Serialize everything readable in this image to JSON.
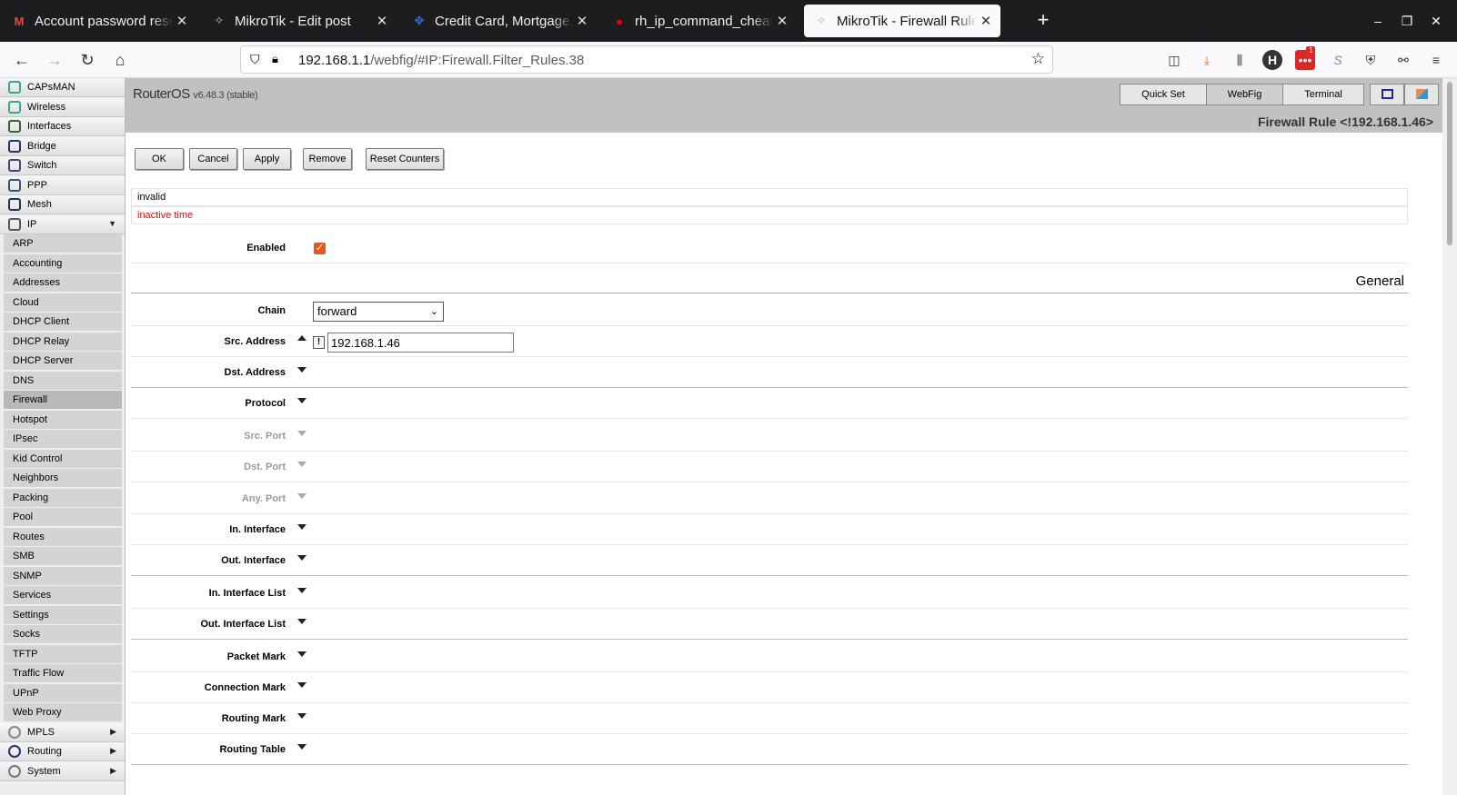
{
  "browser": {
    "tabs": [
      {
        "title": "Account password reset - ",
        "icon": "gmail-icon",
        "active": false
      },
      {
        "title": "MikroTik - Edit post",
        "icon": "mikrotik-icon",
        "active": false
      },
      {
        "title": "Credit Card, Mortgage, B",
        "icon": "chase-icon",
        "active": false
      },
      {
        "title": "rh_ip_command_cheatsh",
        "icon": "redhat-icon",
        "active": false
      },
      {
        "title": "MikroTik - Firewall Rule <",
        "icon": "mikrotik-icon",
        "active": true
      }
    ],
    "close_glyph": "✕",
    "new_tab_glyph": "+",
    "url_host": "192.168.1.1",
    "url_path": "/webfig/#IP:Firewall.Filter_Rules.38",
    "download_badge": "1"
  },
  "sidebar": {
    "top_items": [
      {
        "label": "CAPsMAN",
        "icon": "capsman-icon"
      },
      {
        "label": "Wireless",
        "icon": "wireless-icon"
      },
      {
        "label": "Interfaces",
        "icon": "interfaces-icon"
      },
      {
        "label": "Bridge",
        "icon": "bridge-icon"
      },
      {
        "label": "Switch",
        "icon": "switch-icon"
      },
      {
        "label": "PPP",
        "icon": "ppp-icon"
      },
      {
        "label": "Mesh",
        "icon": "mesh-icon"
      },
      {
        "label": "IP",
        "icon": "ip-icon",
        "arrow": "▼"
      }
    ],
    "ip_sub_items": [
      "ARP",
      "Accounting",
      "Addresses",
      "Cloud",
      "DHCP Client",
      "DHCP Relay",
      "DHCP Server",
      "DNS",
      "Firewall",
      "Hotspot",
      "IPsec",
      "Kid Control",
      "Neighbors",
      "Packing",
      "Pool",
      "Routes",
      "SMB",
      "SNMP",
      "Services",
      "Settings",
      "Socks",
      "TFTP",
      "Traffic Flow",
      "UPnP",
      "Web Proxy"
    ],
    "selected_sub": "Firewall",
    "bottom_items": [
      {
        "label": "MPLS",
        "icon": "mpls-icon",
        "arrow": "▶"
      },
      {
        "label": "Routing",
        "icon": "routing-icon",
        "arrow": "▶"
      },
      {
        "label": "System",
        "icon": "system-icon",
        "arrow": "▶"
      }
    ]
  },
  "header": {
    "brand": "RouterOS",
    "version": "v6.48.3 (stable)",
    "quick_set": "Quick Set",
    "webfig": "WebFig",
    "terminal": "Terminal",
    "page_title": "Firewall Rule <!192.168.1.46>"
  },
  "actions": {
    "ok": "OK",
    "cancel": "Cancel",
    "apply": "Apply",
    "remove": "Remove",
    "reset_counters": "Reset Counters"
  },
  "status": {
    "line1": "invalid",
    "line2": "inactive time"
  },
  "form": {
    "enabled_label": "Enabled",
    "enabled_checked": true,
    "enabled_glyph": "✓",
    "section_general": "General",
    "chain_label": "Chain",
    "chain_value": "forward",
    "chain_chevron": "⌄",
    "src_address_label": "Src. Address",
    "src_negate": "!",
    "src_address_value": "192.168.1.46",
    "fields": [
      {
        "label": "Dst. Address",
        "muted": false,
        "sep": true
      },
      {
        "label": "Protocol",
        "muted": false,
        "sep": false
      },
      {
        "label": "Src. Port",
        "muted": true,
        "sep": false
      },
      {
        "label": "Dst. Port",
        "muted": true,
        "sep": false
      },
      {
        "label": "Any. Port",
        "muted": true,
        "sep": false
      },
      {
        "label": "In. Interface",
        "muted": false,
        "sep": false
      },
      {
        "label": "Out. Interface",
        "muted": false,
        "sep": true
      },
      {
        "label": "In. Interface List",
        "muted": false,
        "sep": false
      },
      {
        "label": "Out. Interface List",
        "muted": false,
        "sep": true
      },
      {
        "label": "Packet Mark",
        "muted": false,
        "sep": false
      },
      {
        "label": "Connection Mark",
        "muted": false,
        "sep": false
      },
      {
        "label": "Routing Mark",
        "muted": false,
        "sep": false
      },
      {
        "label": "Routing Table",
        "muted": false,
        "sep": true
      }
    ]
  },
  "colors": {
    "accent_checkbox": "#e8571f",
    "warn_text": "#dd1111",
    "header_bg": "#c1c1c1",
    "tabbar_bg": "#1d1d1f"
  }
}
